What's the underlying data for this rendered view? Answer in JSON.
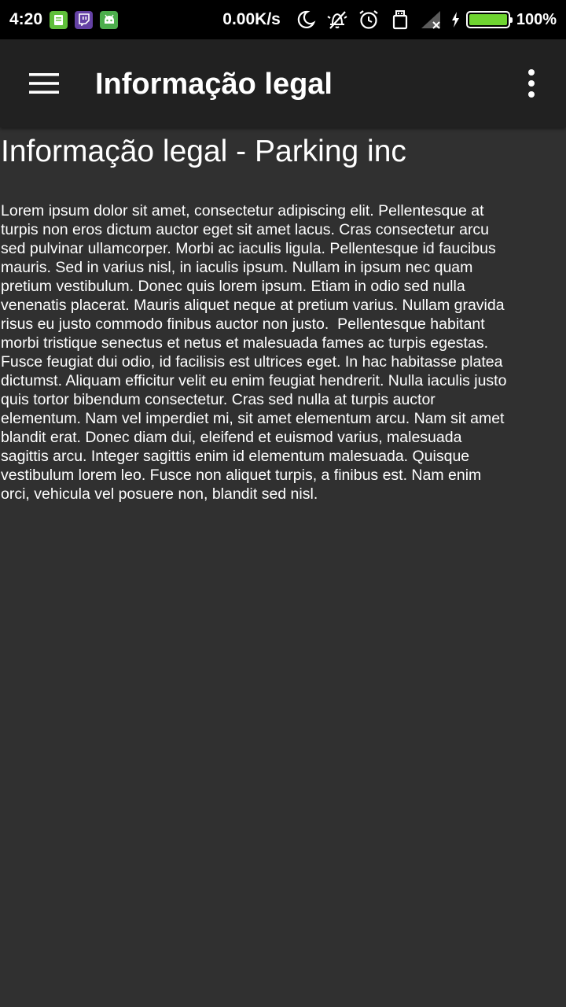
{
  "status_bar": {
    "time": "4:20",
    "network_speed": "0.00K/s",
    "battery_percent": "100%",
    "battery_level": 1.0,
    "notification_icons": [
      "notes-app-icon",
      "twitch-icon",
      "android-app-icon"
    ],
    "system_icons": [
      "moon-icon",
      "vibrate-off-icon",
      "alarm-icon",
      "storage-icon",
      "signal-icon",
      "charging-icon"
    ],
    "colors": {
      "battery": "#6fd431",
      "twitch": "#6441a4",
      "notes": "#5fbf3a",
      "android_app": "#4cae4c"
    }
  },
  "app_bar": {
    "title": "Informação legal",
    "menu_icon": "hamburger-menu-icon",
    "overflow_icon": "more-vert-icon",
    "background": "#212121"
  },
  "content": {
    "heading": "Informação legal - Parking inc",
    "body": "Lorem ipsum dolor sit amet, consectetur adipiscing elit. Pellentesque at turpis non eros dictum auctor eget sit amet lacus. Cras consectetur arcu sed pulvinar ullamcorper. Morbi ac iaculis ligula. Pellentesque id faucibus mauris. Sed in varius nisl, in iaculis ipsum. Nullam in ipsum nec quam pretium vestibulum. Donec quis lorem ipsum. Etiam in odio sed nulla venenatis placerat. Mauris aliquet neque at pretium varius. Nullam gravida risus eu justo commodo finibus auctor non justo.  Pellentesque habitant morbi tristique senectus et netus et malesuada fames ac turpis egestas. Fusce feugiat dui odio, id facilisis est ultrices eget. In hac habitasse platea dictumst. Aliquam efficitur velit eu enim feugiat hendrerit. Nulla iaculis justo quis tortor bibendum consectetur. Cras sed nulla at turpis auctor elementum. Nam vel imperdiet mi, sit amet elementum arcu. Nam sit amet blandit erat. Donec diam dui, eleifend et euismod varius, malesuada sagittis arcu. Integer sagittis enim id elementum malesuada. Quisque vestibulum lorem leo. Fusce non aliquet turpis, a finibus est. Nam enim orci, vehicula vel posuere non, blandit sed nisl.",
    "background": "#303030"
  }
}
